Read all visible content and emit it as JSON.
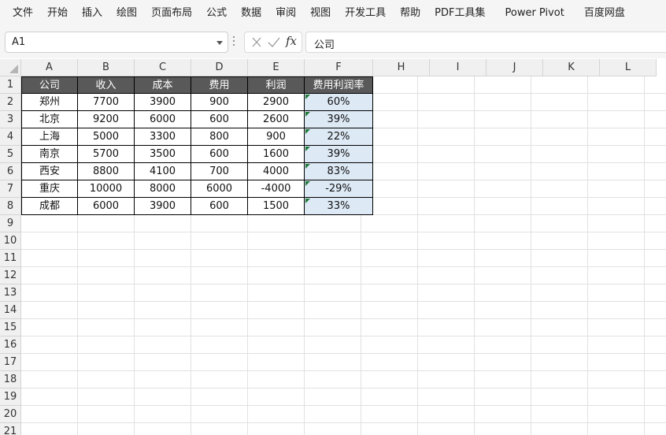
{
  "menu": [
    "文件",
    "开始",
    "插入",
    "绘图",
    "页面布局",
    "公式",
    "数据",
    "审阅",
    "视图",
    "开发工具",
    "帮助",
    "PDF工具集",
    "Power Pivot",
    "百度网盘"
  ],
  "name_box": {
    "value": "A1"
  },
  "formula_bar": {
    "fx_label": "fx",
    "value": "公司"
  },
  "columns": [
    "A",
    "B",
    "C",
    "D",
    "E",
    "F",
    "H",
    "I",
    "J",
    "K",
    "L"
  ],
  "rows": [
    "1",
    "2",
    "3",
    "4",
    "5",
    "6",
    "7",
    "8",
    "9",
    "10",
    "11",
    "12",
    "13",
    "14",
    "15",
    "16",
    "17",
    "18",
    "19",
    "20",
    "21"
  ],
  "table": {
    "headers": [
      "公司",
      "收入",
      "成本",
      "费用",
      "利润",
      "费用利润率"
    ],
    "rows": [
      [
        "郑州",
        "7700",
        "3900",
        "900",
        "2900",
        "60%"
      ],
      [
        "北京",
        "9200",
        "6000",
        "600",
        "2600",
        "39%"
      ],
      [
        "上海",
        "5000",
        "3300",
        "800",
        "900",
        "22%"
      ],
      [
        "南京",
        "5700",
        "3500",
        "600",
        "1600",
        "39%"
      ],
      [
        "西安",
        "8800",
        "4100",
        "700",
        "4000",
        "83%"
      ],
      [
        "重庆",
        "10000",
        "8000",
        "6000",
        "-4000",
        "-29%"
      ],
      [
        "成都",
        "6000",
        "3900",
        "600",
        "1500",
        "33%"
      ]
    ]
  },
  "colors": {
    "header_fill": "#595959",
    "header_text": "#ffffff",
    "pct_fill": "#dde9f5",
    "error_indicator": "#1f7a3a"
  },
  "icons": {
    "cancel": "close-icon",
    "enter": "check-icon",
    "dropdown": "chevron-down-icon"
  }
}
